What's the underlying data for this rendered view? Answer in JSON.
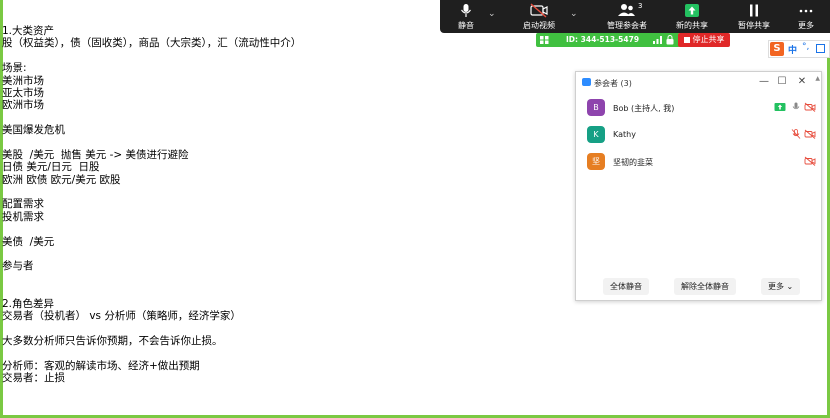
{
  "document": {
    "lines": [
      "1.大类资产",
      "股（权益类），债（固收类），商品（大宗类），汇（流动性中介）",
      "",
      "场景:",
      "美洲市场",
      "亚太市场",
      "欧洲市场",
      "",
      "美国爆发危机",
      "",
      "美股  /美元  抛售 美元 -> 美债进行避险",
      "日债 美元/日元  日股",
      "欧洲 欧债 欧元/美元 欧股",
      "",
      "配置需求",
      "投机需求",
      "",
      "美债  /美元",
      "",
      "参与者",
      "",
      "",
      "2.角色差异",
      "交易者（投机者） vs 分析师（策略师，经济学家）",
      "",
      "大多数分析师只告诉你预期，不会告诉你止损。",
      "",
      "分析师：客观的解读市场、经济+做出预期",
      "交易者：止损"
    ]
  },
  "toolbar": {
    "mute_label": "静音",
    "video_label": "启动视频",
    "participants_label": "管理参会者",
    "participants_count": "3",
    "new_share_label": "新的共享",
    "pause_share_label": "暂停共享",
    "more_label": "更多"
  },
  "status": {
    "meeting_id": "ID: 344-513-5479",
    "stop_share_label": "停止共享"
  },
  "ime": {
    "logo": "S",
    "mode": "中",
    "punct": "°,"
  },
  "panel": {
    "title": "参会者 (3)",
    "participants": [
      {
        "initial": "B",
        "name": "Bob (主持人, 我)",
        "color": "#8e44ad"
      },
      {
        "initial": "K",
        "name": "Kathy",
        "color": "#16a085"
      },
      {
        "initial": "坚",
        "name": "坚韧的韭菜",
        "color": "#e67e22"
      }
    ],
    "mute_all_label": "全体静音",
    "unmute_all_label": "解除全体静音",
    "more_label": "更多"
  },
  "colors": {
    "share_border": "#7ac943",
    "toolbar_bg": "#1f1f1f",
    "stop_share": "#e02828",
    "muted_red": "#e74c3c",
    "accent_blue": "#2d8cff"
  }
}
